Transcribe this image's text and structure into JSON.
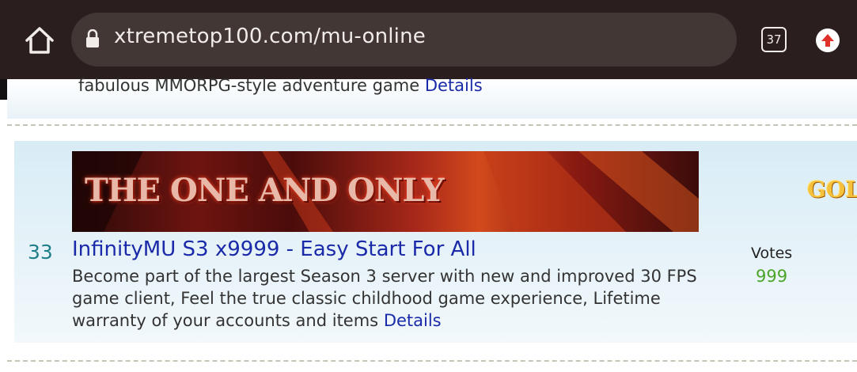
{
  "browser": {
    "url": "xtremetop100.com/mu-online",
    "tab_count": "37",
    "icons": [
      "home-icon",
      "lock-icon",
      "tabs-icon",
      "update-icon"
    ]
  },
  "previous_entry": {
    "description_tail": "fabulous MMORPG-style adventure game",
    "details_label": "Details"
  },
  "entry": {
    "rank": "33",
    "banner_text": "THE ONE AND ONLY",
    "title": "InfinityMU S3 x9999 - Easy Start For All",
    "description": "Become part of the largest Season 3 server with new and improved 30 FPS game client, Feel the true classic childhood game experience, Lifetime warranty of your accounts and items",
    "details_label": "Details",
    "votes_label": "Votes",
    "votes_count": "999"
  },
  "side_banner": {
    "text": "GOLD"
  },
  "colors": {
    "toolbar": "#2a1f1e",
    "urlbar": "#433735",
    "link": "#1a2aa8",
    "rank": "#1e7f8a",
    "votes": "#4aa52a"
  }
}
